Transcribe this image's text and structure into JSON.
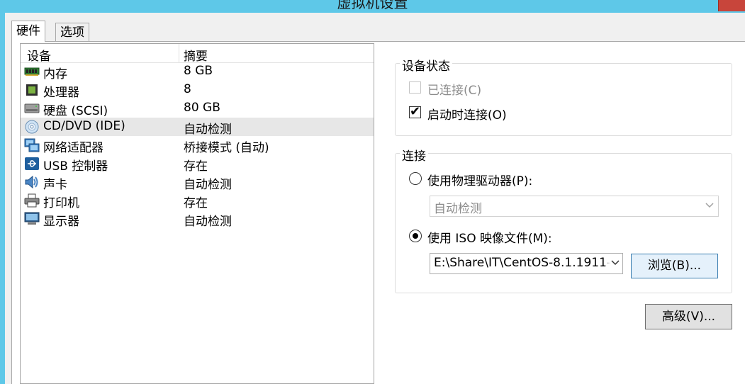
{
  "window": {
    "title": "虚拟机设置"
  },
  "tabs": [
    {
      "label": "硬件",
      "active": true
    },
    {
      "label": "选项",
      "active": false
    }
  ],
  "device_list": {
    "columns": {
      "device": "设备",
      "summary": "摘要"
    },
    "selected_index": 3,
    "rows": [
      {
        "name": "内存",
        "summary": "8 GB",
        "icon": "memory-icon"
      },
      {
        "name": "处理器",
        "summary": "8",
        "icon": "processor-icon"
      },
      {
        "name": "硬盘 (SCSI)",
        "summary": "80 GB",
        "icon": "hard-disk-icon"
      },
      {
        "name": "CD/DVD (IDE)",
        "summary": "自动检测",
        "icon": "cd-dvd-icon"
      },
      {
        "name": "网络适配器",
        "summary": "桥接模式 (自动)",
        "icon": "network-adapter-icon"
      },
      {
        "name": "USB 控制器",
        "summary": "存在",
        "icon": "usb-icon"
      },
      {
        "name": "声卡",
        "summary": "自动检测",
        "icon": "sound-card-icon"
      },
      {
        "name": "打印机",
        "summary": "存在",
        "icon": "printer-icon"
      },
      {
        "name": "显示器",
        "summary": "自动检测",
        "icon": "display-icon"
      }
    ]
  },
  "device_status": {
    "title": "设备状态",
    "connected": {
      "label": "已连接(C)",
      "checked": false,
      "disabled": true
    },
    "connect_at_power_on": {
      "label": "启动时连接(O)",
      "checked": true,
      "disabled": false
    }
  },
  "connection": {
    "title": "连接",
    "physical_drive": {
      "label": "使用物理驱动器(P):",
      "selected": false,
      "value": "自动检测"
    },
    "iso_image": {
      "label": "使用 ISO 映像文件(M):",
      "selected": true,
      "value": "E:\\Share\\IT\\CentOS-8.1.1911-"
    },
    "browse_label": "浏览(B)..."
  },
  "advanced_label": "高级(V)...",
  "colors": {
    "title_bar": "#5ec8e8",
    "dialog_bg": "#f0f0f0",
    "selected_row": "#e7e7e7",
    "close_button": "#c8453b"
  }
}
